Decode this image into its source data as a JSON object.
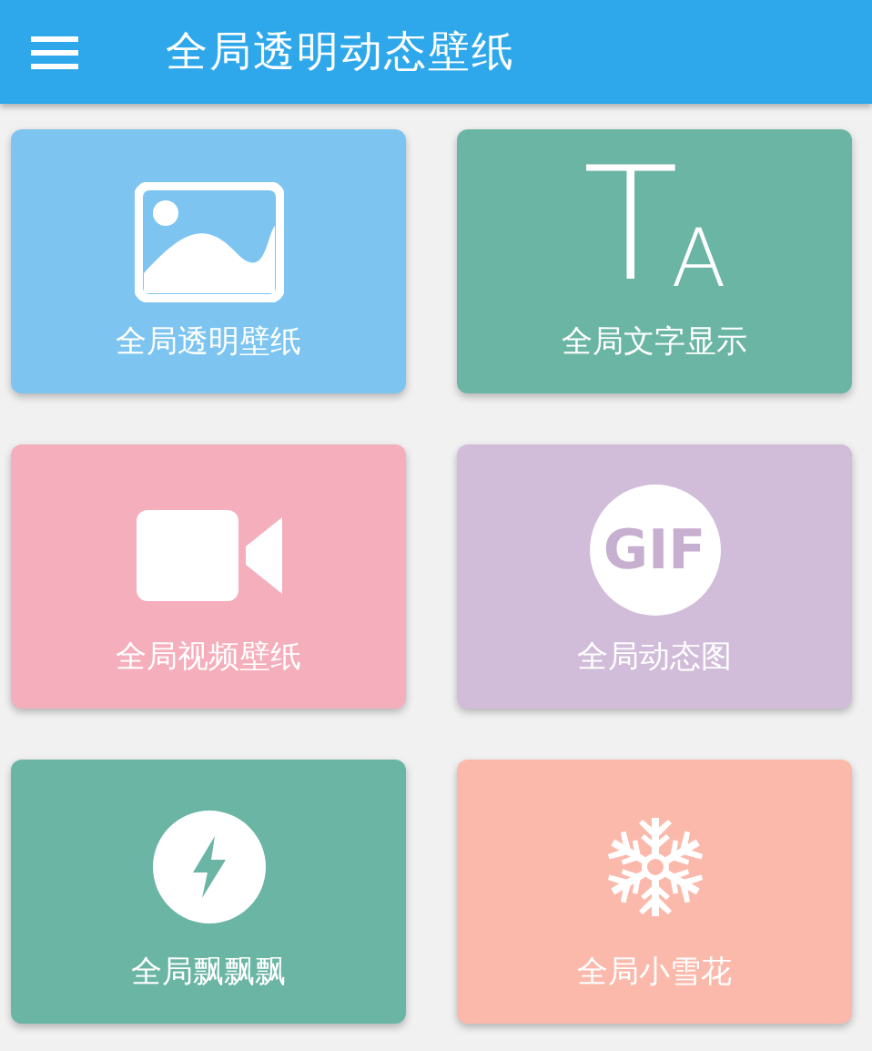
{
  "app_bar": {
    "title": "全局透明动态壁纸"
  },
  "cards": [
    {
      "label": "全局透明壁纸",
      "color": "#7dc5f0"
    },
    {
      "label": "全局文字显示",
      "color": "#6bb5a5"
    },
    {
      "label": "全局视频壁纸",
      "color": "#f5aebb"
    },
    {
      "label": "全局动态图",
      "color": "#d1bcd9"
    },
    {
      "label": "全局飘飘飘",
      "color": "#6bb5a5"
    },
    {
      "label": "全局小雪花",
      "color": "#fbb9ab"
    }
  ],
  "card_icons": [
    {
      "kind": "image"
    },
    {
      "kind": "letters",
      "letters": [
        "T",
        "A"
      ]
    },
    {
      "kind": "video"
    },
    {
      "kind": "badge",
      "badge": "GIF"
    },
    {
      "kind": "bolt"
    },
    {
      "kind": "snowflake"
    }
  ]
}
